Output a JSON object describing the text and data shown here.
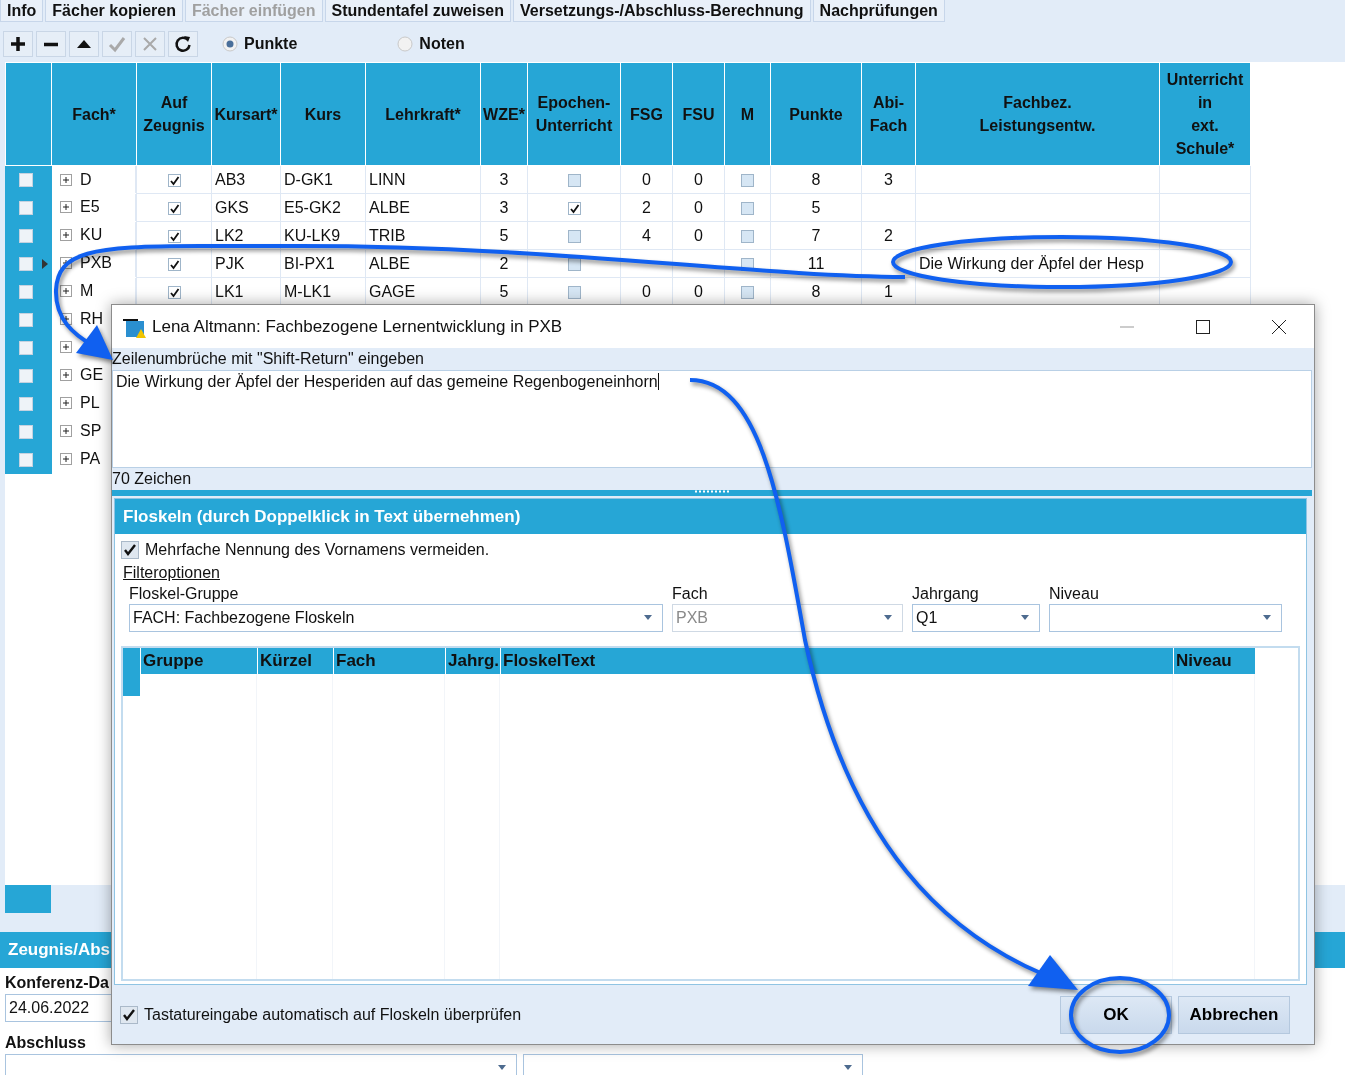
{
  "tabs": [
    {
      "label": "Info",
      "disabled": false
    },
    {
      "label": "Fächer kopieren",
      "disabled": false
    },
    {
      "label": "Fächer einfügen",
      "disabled": true
    },
    {
      "label": "Stundentafel zuweisen",
      "disabled": false
    },
    {
      "label": "Versetzungs-/Abschluss-Berechnung",
      "disabled": false
    },
    {
      "label": "Nachprüfungen",
      "disabled": false
    }
  ],
  "toolbar": {
    "buttons": [
      {
        "kind": "add",
        "disabled": false
      },
      {
        "kind": "remove",
        "disabled": false
      },
      {
        "kind": "up",
        "disabled": false
      },
      {
        "kind": "confirm",
        "disabled": true
      },
      {
        "kind": "cancel",
        "disabled": true
      },
      {
        "kind": "refresh",
        "disabled": false
      }
    ],
    "view_options": [
      {
        "label": "Punkte",
        "selected": true
      },
      {
        "label": "Noten",
        "selected": false
      }
    ]
  },
  "table": {
    "columns": [
      "Fach*",
      "Auf\nZeugnis",
      "Kursart*",
      "Kurs",
      "Lehrkraft*",
      "WZE*",
      "Epochen-\nUnterricht",
      "FSG",
      "FSU",
      "M",
      "Punkte",
      "Abi-\nFach",
      "Fachbez.\nLeistungsentw.",
      "Unterricht\nin\next.\nSchule*"
    ],
    "rows": [
      {
        "marked": false,
        "current": false,
        "fach": "D",
        "auf_zeugnis": true,
        "kursart": "AB3",
        "kurs": "D-GK1",
        "lehrkraft": "LINN",
        "wze": "3",
        "epochen": false,
        "fsg": "0",
        "fsu": "0",
        "m": false,
        "punkte": "8",
        "abi": "3"
      },
      {
        "marked": false,
        "current": false,
        "fach": "E5",
        "auf_zeugnis": true,
        "kursart": "GKS",
        "kurs": "E5-GK2",
        "lehrkraft": "ALBE",
        "wze": "3",
        "epochen": true,
        "fsg": "2",
        "fsu": "0",
        "m": false,
        "punkte": "5"
      },
      {
        "marked": false,
        "current": false,
        "fach": "KU",
        "auf_zeugnis": true,
        "kursart": "LK2",
        "kurs": "KU-LK9",
        "lehrkraft": "TRIB",
        "wze": "5",
        "epochen": false,
        "fsg": "4",
        "fsu": "0",
        "m": false,
        "punkte": "7",
        "abi": "2"
      },
      {
        "marked": false,
        "current": true,
        "fach": "PXB",
        "auf_zeugnis": true,
        "kursart": "PJK",
        "kurs": "BI-PX1",
        "lehrkraft": "ALBE",
        "wze": "2",
        "epochen": false,
        "m": false,
        "punkte": "11",
        "fachbez": "Die Wirkung der Äpfel der Hesp"
      },
      {
        "marked": false,
        "current": false,
        "fach": "M",
        "auf_zeugnis": true,
        "kursart": "LK1",
        "kurs": "M-LK1",
        "lehrkraft": "GAGE",
        "wze": "5",
        "epochen": false,
        "fsg": "0",
        "fsu": "0",
        "m": false,
        "punkte": "8",
        "abi": "1"
      },
      {
        "marked": false,
        "current": false,
        "fach": "RH"
      },
      {
        "marked": false,
        "current": false
      },
      {
        "marked": false,
        "current": false,
        "fach": "GE"
      },
      {
        "marked": false,
        "current": false,
        "fach": "PL"
      },
      {
        "marked": false,
        "current": false,
        "fach": "SP"
      },
      {
        "marked": false,
        "current": false,
        "fach": "PA"
      }
    ]
  },
  "report": {
    "title": "Zeugnis/Abs",
    "date_label": "Konferenz-Da",
    "date_value": "24.06.2022",
    "graduation_label": "Abschluss"
  },
  "dialog": {
    "title": "Lena Altmann: Fachbezogene Lernentwicklung in PXB",
    "hint": "Zeilenumbrüche mit \"Shift-Return\" eingeben",
    "text": "Die Wirkung der Äpfel der Hesperiden auf das gemeine Regenbogeneinhorn",
    "char_count": "70 Zeichen",
    "phrases": {
      "title": "Floskeln (durch Doppelklick in Text übernehmen)",
      "avoid_names": {
        "label": "Mehrfache Nennung des Vornamens vermeiden.",
        "checked": true
      },
      "filter_link": "Filteroptionen",
      "filters": [
        {
          "label": "Floskel-Gruppe",
          "value": "FACH: Fachbezogene Floskeln",
          "disabled": false
        },
        {
          "label": "Fach",
          "value": "PXB",
          "disabled": true
        },
        {
          "label": "Jahrgang",
          "value": "Q1",
          "disabled": false
        },
        {
          "label": "Niveau",
          "disabled": false
        }
      ],
      "columns": [
        "Gruppe",
        "Kürzel",
        "Fach",
        "Jahrg.",
        "FloskelText",
        "Niveau"
      ]
    },
    "auto_check": {
      "label": "Tastatureingabe automatisch auf Floskeln überprüfen",
      "checked": true
    },
    "buttons": [
      "OK",
      "Abbrechen"
    ]
  }
}
